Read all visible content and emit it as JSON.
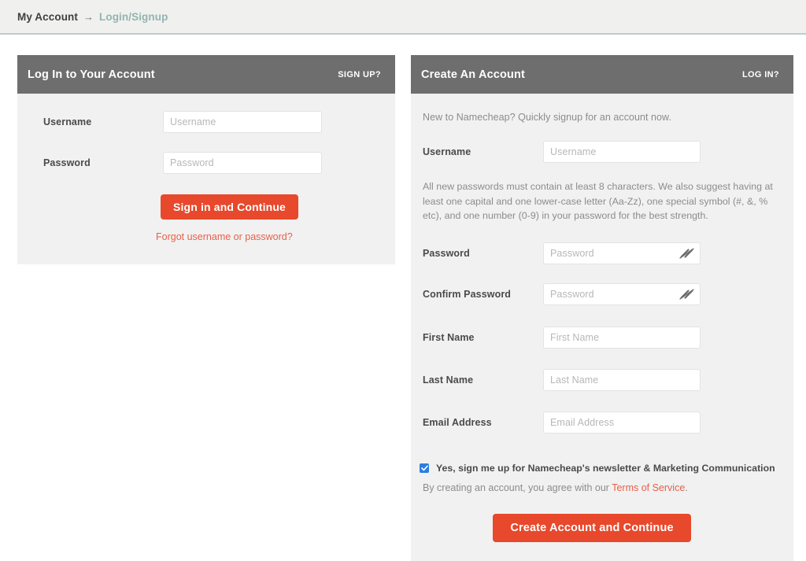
{
  "breadcrumb": {
    "current": "My Account",
    "arrow": "→",
    "link": "Login/Signup"
  },
  "login_panel": {
    "title": "Log In to Your Account",
    "switch_link": "SIGN UP?",
    "fields": [
      {
        "label": "Username",
        "placeholder": "Username",
        "value": ""
      },
      {
        "label": "Password",
        "placeholder": "Password",
        "value": ""
      }
    ],
    "submit_label": "Sign in and Continue",
    "forgot_link": "Forgot username or password?"
  },
  "signup_panel": {
    "title": "Create An Account",
    "switch_link": "LOG IN?",
    "intro": "New to Namecheap? Quickly signup for an account now.",
    "username": {
      "label": "Username",
      "placeholder": "Username",
      "value": ""
    },
    "password_note": "All new passwords must contain at least 8 characters.\nWe also suggest having at least one capital and one lower-case letter (Aa-Zz), one special symbol (#, &, % etc), and one number (0-9) in your password for the best strength.",
    "password": {
      "label": "Password",
      "placeholder": "Password",
      "value": ""
    },
    "confirm_password": {
      "label": "Confirm Password",
      "placeholder": "Password",
      "value": ""
    },
    "first_name": {
      "label": "First Name",
      "placeholder": "First Name",
      "value": ""
    },
    "last_name": {
      "label": "Last Name",
      "placeholder": "Last Name",
      "value": ""
    },
    "email": {
      "label": "Email Address",
      "placeholder": "Email Address",
      "value": ""
    },
    "newsletter": {
      "checked": true,
      "label": "Yes, sign me up for Namecheap's newsletter & Marketing Communication"
    },
    "tos_prefix": "By creating an account, you agree with our ",
    "tos_link": "Terms of Service",
    "tos_suffix": ".",
    "submit_label": "Create Account and Continue"
  },
  "icons": {
    "password_toggle": "eye-slash-icon",
    "checkbox_check": "check-icon"
  },
  "colors": {
    "accent_orange": "#e8482b",
    "link_orange": "#e8604a",
    "header_gray": "#6e6e6e",
    "panel_bg": "#f1f1f1",
    "breadcrumb_link_teal": "#93b4b0",
    "checkbox_blue": "#2a7fe0"
  }
}
